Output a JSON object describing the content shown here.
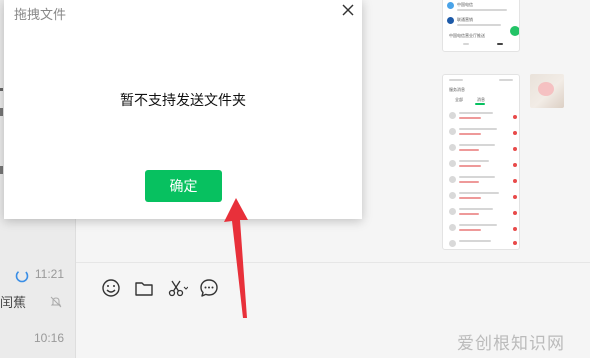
{
  "dialog": {
    "title": "拖拽文件",
    "message": "暂不支持发送文件夹",
    "ok_label": "确定"
  },
  "chat_list": {
    "rows": [
      {
        "time": "11:21",
        "snippet": "闰蕉"
      },
      {
        "time": "10:16",
        "snippet": ""
      }
    ]
  },
  "thumbnails": {
    "top_items": [
      "中国电信",
      "联通营销",
      "中国电信营业厅推送"
    ],
    "service_title": "服务消息",
    "tabs": [
      "全部",
      "消息"
    ]
  },
  "toolbar": {
    "items": [
      "emoji",
      "folder",
      "screenshot",
      "chat-history"
    ]
  },
  "watermark": "爱创根知识网",
  "colors": {
    "accent": "#07c160",
    "annotation": "#e8303a"
  }
}
